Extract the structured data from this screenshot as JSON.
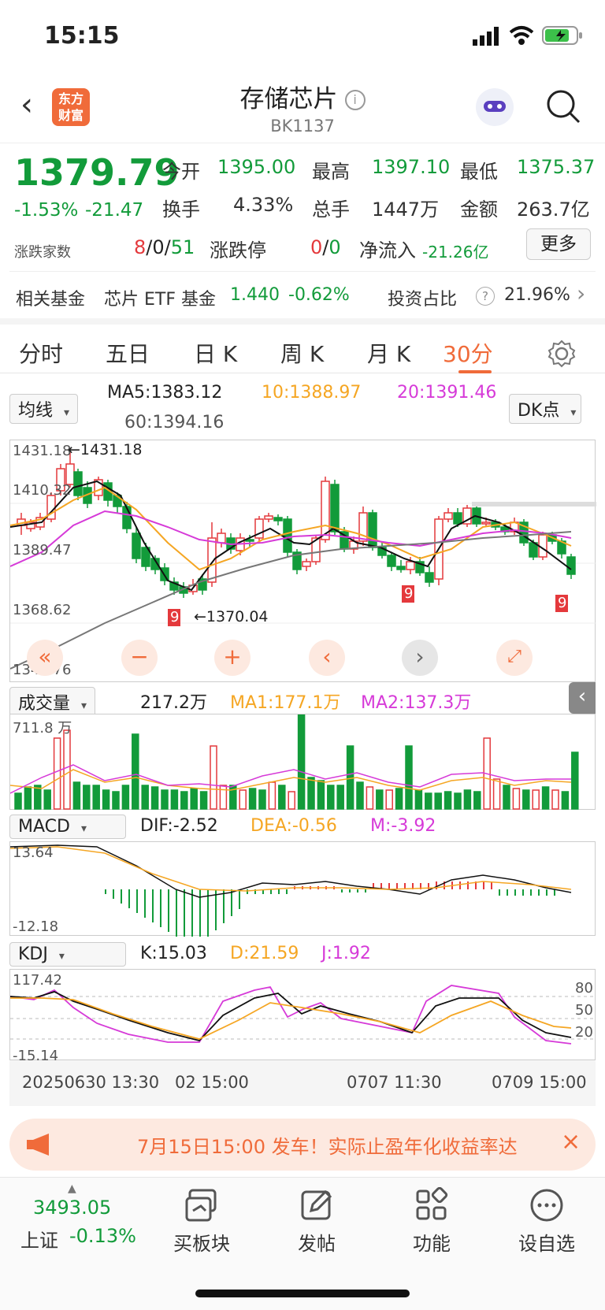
{
  "status": {
    "time": "15:15"
  },
  "header": {
    "title": "存储芯片",
    "code": "BK1137",
    "logo_line1": "东方",
    "logo_line2": "财富"
  },
  "quote": {
    "price": "1379.79",
    "pct": "-1.53%",
    "chg": "-21.47",
    "open_label": "今开",
    "open": "1395.00",
    "high_label": "最高",
    "high": "1397.10",
    "low_label": "最低",
    "low": "1375.37",
    "turn_label": "换手",
    "turn": "4.33%",
    "vol_label": "总手",
    "vol": "1447万",
    "amt_label": "金额",
    "amt": "263.7亿",
    "count_label": "涨跌家数",
    "count_up": "8",
    "sep1": "/",
    "count_flat": "0",
    "sep2": "/",
    "count_down": "51",
    "limit_label": "涨跌停",
    "limit_up": "0",
    "sep3": "/",
    "limit_down": "0",
    "inflow_label": "净流入",
    "inflow": "-21.26亿",
    "more_btn": "更多"
  },
  "fund": {
    "label": "相关基金",
    "name": "芯片 ETF 基金",
    "price": "1.440",
    "pct": "-0.62%",
    "ratio_label": "投资占比",
    "ratio": "21.96%"
  },
  "tabs": [
    "分时",
    "五日",
    "日 K",
    "周 K",
    "月 K",
    "30分"
  ],
  "active_tab": "30分",
  "ma": {
    "select": "均线",
    "ma5": "MA5:1383.12",
    "ma10": "10:1388.97",
    "ma20": "20:1391.46",
    "ma60": "60:1394.16",
    "dk": "DK点"
  },
  "kline": {
    "y_top": "1431.18",
    "y_2": "1410.32",
    "y_3": "1389.47",
    "y_4": "1368.62",
    "y_bottom": "1347.76",
    "max_label": "1431.18",
    "min_label": "1370.04"
  },
  "volume": {
    "select": "成交量",
    "value": "217.2万",
    "ma1": "MA1:177.1万",
    "ma2": "MA2:137.3万",
    "y_top": "711.8 万"
  },
  "macd": {
    "select": "MACD",
    "dif": "DIF:-2.52",
    "dea": "DEA:-0.56",
    "m": "M:-3.92",
    "y_top": "13.64",
    "y_bottom": "-12.18"
  },
  "kdj": {
    "select": "KDJ",
    "k": "K:15.03",
    "d": "D:21.59",
    "j": "J:1.92",
    "y_top": "117.42",
    "y_bottom": "-15.14",
    "l80": "80",
    "l50": "50",
    "l20": "20"
  },
  "xaxis": {
    "t1": "20250630 13:30",
    "t2": "02 15:00",
    "t3": "0707 11:30",
    "t4": "0709 15:00"
  },
  "banner": {
    "text": "7月15日15:00 发车！实际止盈年化收益率达"
  },
  "bottom": {
    "index_value": "3493.05",
    "index_name": "上证",
    "index_pct": "-0.13%",
    "b1": "买板块",
    "b2": "发帖",
    "b3": "功能",
    "b4": "设自选"
  },
  "colors": {
    "up": "#e4393c",
    "down": "#129b3a",
    "ma10": "#f5a623",
    "ma20": "#d63ad8",
    "accent": "#f06b3a"
  }
}
